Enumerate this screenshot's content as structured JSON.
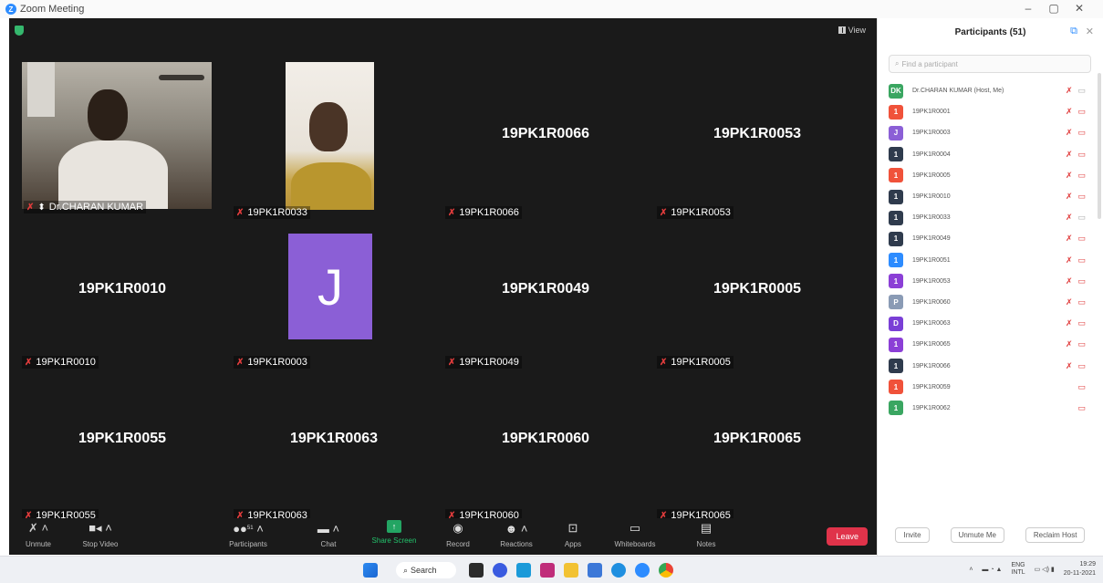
{
  "window": {
    "title": "Zoom Meeting",
    "minimize": "–",
    "maximize": "▢",
    "close": "✕"
  },
  "stage": {
    "view_label": "View"
  },
  "tiles": [
    {
      "name": "Dr.CHARAN KUMAR",
      "label": "Dr.CHARAN KUMAR",
      "type": "video"
    },
    {
      "name": "19PK1R0033",
      "label": "19PK1R0033",
      "type": "video"
    },
    {
      "name": "19PK1R0066",
      "label": "19PK1R0066",
      "type": "name"
    },
    {
      "name": "19PK1R0053",
      "label": "19PK1R0053",
      "type": "name"
    },
    {
      "name": "19PK1R0010",
      "label": "19PK1R0010",
      "type": "name"
    },
    {
      "name": "J",
      "label": "19PK1R0003",
      "type": "avatar"
    },
    {
      "name": "19PK1R0049",
      "label": "19PK1R0049",
      "type": "name"
    },
    {
      "name": "19PK1R0005",
      "label": "19PK1R0005",
      "type": "name"
    },
    {
      "name": "19PK1R0055",
      "label": "19PK1R0055",
      "type": "name"
    },
    {
      "name": "19PK1R0063",
      "label": "19PK1R0063",
      "type": "name"
    },
    {
      "name": "19PK1R0060",
      "label": "19PK1R0060",
      "type": "name"
    },
    {
      "name": "19PK1R0065",
      "label": "19PK1R0065",
      "type": "name"
    }
  ],
  "toolbar": {
    "unmute": "Unmute",
    "stop_video": "Stop Video",
    "participants": "Participants",
    "participants_count": "51",
    "chat": "Chat",
    "share_screen": "Share Screen",
    "record": "Record",
    "reactions": "Reactions",
    "apps": "Apps",
    "whiteboards": "Whiteboards",
    "notes": "Notes",
    "leave": "Leave"
  },
  "panel": {
    "title": "Participants (51)",
    "search_placeholder": "Find a participant",
    "participants": [
      {
        "initials": "DK",
        "name": "Dr.CHARAN KUMAR (Host, Me)",
        "color": "#3aa661",
        "cam_on": true,
        "mic": true
      },
      {
        "initials": "1",
        "name": "19PK1R0001",
        "color": "#f0523a",
        "cam_on": false,
        "mic": true
      },
      {
        "initials": "J",
        "name": "19PK1R0003",
        "color": "#8b5fd6",
        "cam_on": false,
        "mic": true
      },
      {
        "initials": "1",
        "name": "19PK1R0004",
        "color": "#2f3b4d",
        "cam_on": false,
        "mic": true
      },
      {
        "initials": "1",
        "name": "19PK1R0005",
        "color": "#f0523a",
        "cam_on": false,
        "mic": true
      },
      {
        "initials": "1",
        "name": "19PK1R0010",
        "color": "#2f3b4d",
        "cam_on": false,
        "mic": true
      },
      {
        "initials": "1",
        "name": "19PK1R0033",
        "color": "#2f3b4d",
        "cam_on": true,
        "mic": true
      },
      {
        "initials": "1",
        "name": "19PK1R0049",
        "color": "#2f3b4d",
        "cam_on": false,
        "mic": true
      },
      {
        "initials": "1",
        "name": "19PK1R0051",
        "color": "#2d8cff",
        "cam_on": false,
        "mic": true
      },
      {
        "initials": "1",
        "name": "19PK1R0053",
        "color": "#8b3fd6",
        "cam_on": false,
        "mic": true
      },
      {
        "initials": "P",
        "name": "19PK1R0060",
        "color": "#8a9bb5",
        "cam_on": false,
        "mic": true
      },
      {
        "initials": "D",
        "name": "19PK1R0063",
        "color": "#7a3fd6",
        "cam_on": false,
        "mic": true
      },
      {
        "initials": "1",
        "name": "19PK1R0065",
        "color": "#8b3fd6",
        "cam_on": false,
        "mic": true
      },
      {
        "initials": "1",
        "name": "19PK1R0066",
        "color": "#2f3b4d",
        "cam_on": false,
        "mic": true
      },
      {
        "initials": "1",
        "name": "19PK1R0059",
        "color": "#f0523a",
        "cam_on": false,
        "mic": false
      },
      {
        "initials": "1",
        "name": "19PK1R0062",
        "color": "#3aa661",
        "cam_on": false,
        "mic": false
      }
    ],
    "invite": "Invite",
    "unmute_me": "Unmute Me",
    "reclaim_host": "Reclaim Host"
  },
  "taskbar": {
    "search": "Search",
    "lang_top": "ENG",
    "lang_bottom": "INTL",
    "time": "19:29",
    "date": "20-11-2021"
  }
}
